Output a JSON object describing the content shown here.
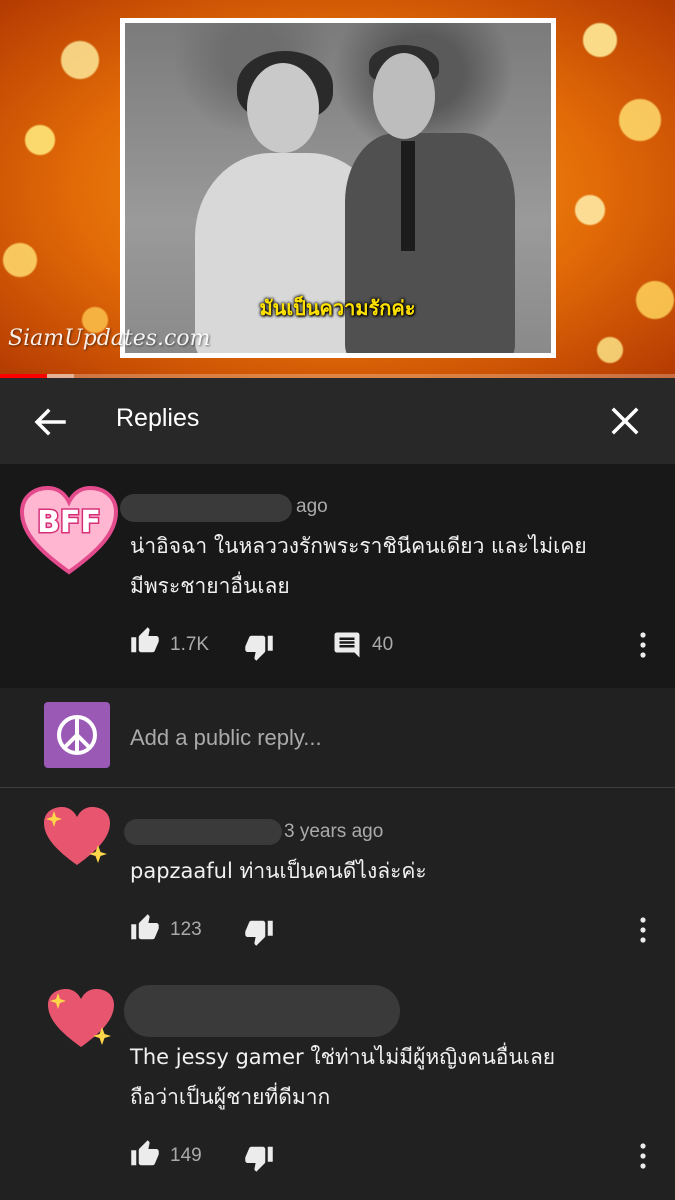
{
  "video": {
    "caption": "มันเป็นความรักค่ะ",
    "watermark": "SiamUpdates.com",
    "progress": 0.07,
    "buffered": 0.04
  },
  "header": {
    "title": "Replies",
    "back_icon": "arrow-left-icon",
    "close_icon": "close-icon"
  },
  "parent_comment": {
    "avatar_text": "BFF",
    "time_suffix": "ago",
    "text_line1": "น่าอิจฉา ในหลววงรักพระราชินีคนเดียว และไม่เคย",
    "text_line2": "มีพระชายาอื่นเลย",
    "likes": "1.7K",
    "replies_count": "40"
  },
  "reply_input": {
    "placeholder": "Add a public reply..."
  },
  "replies": [
    {
      "time": "3 years ago",
      "text_line1": "papzaaful  ท่านเป็นคนดีไงล่ะค่ะ",
      "text_line2": "",
      "likes": "123"
    },
    {
      "time": "",
      "text_line1": "The jessy gamer  ใช่ท่านไม่มีผู้หญิงคนอื่นเลย",
      "text_line2": "ถือว่าเป็นผู้ชายที่ดีมาก",
      "likes": "149"
    }
  ],
  "colors": {
    "accent": "#ff0000",
    "background": "#212121",
    "parent_bg": "#181818",
    "header_bg": "#282828",
    "secondary_text": "#aaaaaa"
  }
}
